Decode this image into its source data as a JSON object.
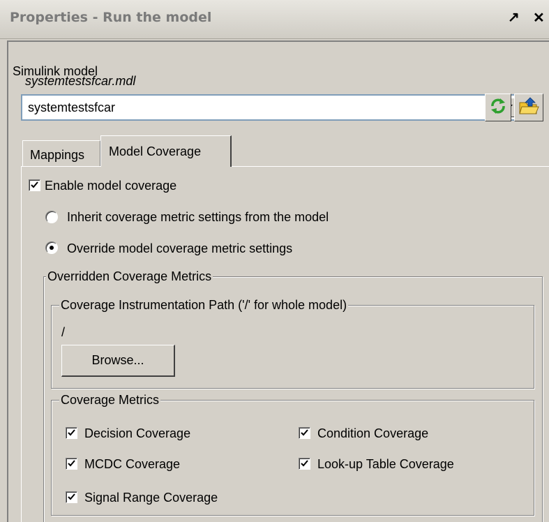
{
  "window": {
    "title": "Properties - Run the model",
    "undock_glyph": "↗",
    "close_glyph": "✕"
  },
  "model": {
    "section_label": "Simulink model",
    "file_name": "systemtestsfcar.mdl",
    "selected_model": "systemtestsfcar"
  },
  "tabs": [
    {
      "label": "Mappings",
      "active": false
    },
    {
      "label": "Model Coverage",
      "active": true
    }
  ],
  "coverage": {
    "enable_label": "Enable model coverage",
    "enable_checked": true,
    "inherit_label": "Inherit coverage metric settings from the model",
    "override_label": "Override model coverage metric settings",
    "selected_option": "override",
    "overridden_group_title": "Overridden Coverage Metrics",
    "instrumentation_group_title": "Coverage Instrumentation Path ('/' for whole model)",
    "instrumentation_path": "/",
    "browse_label": "Browse...",
    "metrics_group_title": "Coverage Metrics",
    "metrics": [
      {
        "label": "Decision Coverage",
        "checked": true
      },
      {
        "label": "Condition Coverage",
        "checked": true
      },
      {
        "label": "MCDC Coverage",
        "checked": true
      },
      {
        "label": "Look-up Table Coverage",
        "checked": true
      },
      {
        "label": "Signal Range Coverage",
        "checked": true
      }
    ]
  },
  "icons": {
    "refresh": "refresh-icon",
    "open_folder": "open-folder-icon",
    "dropdown": "dropdown-arrow-icon"
  },
  "colors": {
    "background": "#d4d0c8",
    "title_text": "#7a7a7a",
    "refresh_green": "#2fa02f",
    "folder_yellow": "#f2c12e",
    "folder_arrow_blue": "#1f5fb8"
  }
}
